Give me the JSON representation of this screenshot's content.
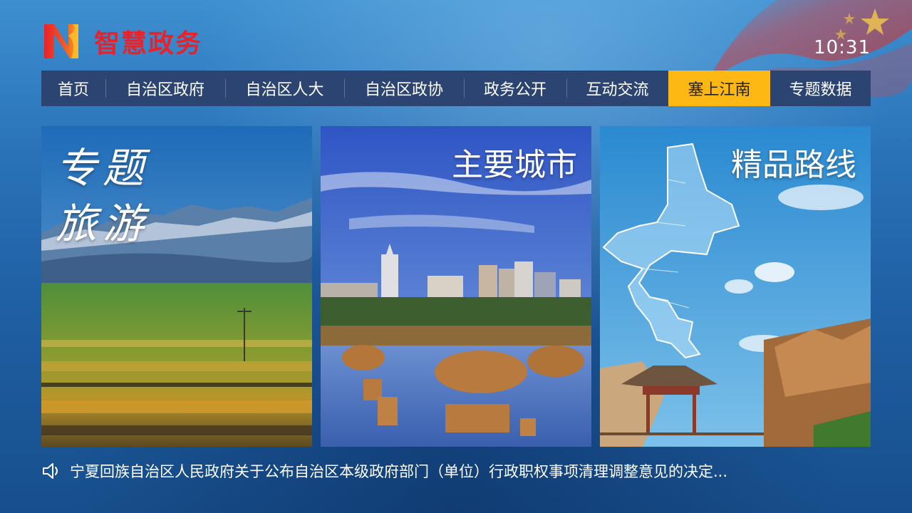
{
  "header": {
    "app_name": "智慧政务",
    "logo_letter": "N",
    "time": "10:31"
  },
  "nav": {
    "items": [
      {
        "label": "首页",
        "active": false
      },
      {
        "label": "自治区政府",
        "active": false
      },
      {
        "label": "自治区人大",
        "active": false
      },
      {
        "label": "自治区政协",
        "active": false
      },
      {
        "label": "政务公开",
        "active": false
      },
      {
        "label": "互动交流",
        "active": false
      },
      {
        "label": "塞上江南",
        "active": true
      },
      {
        "label": "专题数据",
        "active": false
      }
    ]
  },
  "cards": [
    {
      "title": "专题旅游",
      "image": "grassland-mountains"
    },
    {
      "title": "主要城市",
      "image": "city-skyline-lake"
    },
    {
      "title": "精品路线",
      "image": "map-pavilion-cliffs"
    }
  ],
  "ticker": {
    "icon": "speaker-icon",
    "text": "宁夏回族自治区人民政府关于公布自治区本级政府部门（单位）行政职权事项清理调整意见的决定..."
  },
  "colors": {
    "brand_red": "#e8222a",
    "nav_bg": "#2c4472",
    "nav_active": "#fdb813"
  }
}
